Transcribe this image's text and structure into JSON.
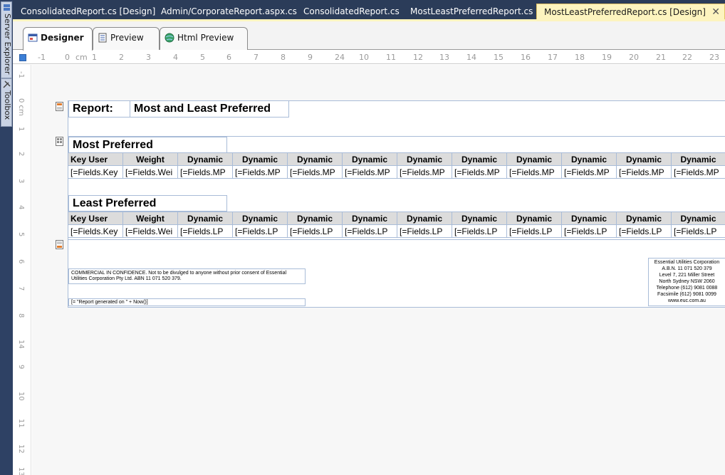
{
  "side_panels": {
    "server_explorer": "Server Explorer",
    "toolbox": "Toolbox"
  },
  "doc_tabs": [
    {
      "label": "ConsolidatedReport.cs [Design]"
    },
    {
      "label": "Admin/CorporateReport.aspx.cs"
    },
    {
      "label": "ConsolidatedReport.cs"
    },
    {
      "label": "MostLeastPreferredReport.cs"
    },
    {
      "label": "MostLeastPreferredReport.cs [Design]",
      "active": true
    }
  ],
  "close_glyph": "✕",
  "view_tabs": {
    "designer": "Designer",
    "preview": "Preview",
    "html_preview": "Html Preview"
  },
  "ruler": {
    "unit": "cm",
    "h_labels": [
      "-1",
      "0",
      "1",
      "2",
      "3",
      "4",
      "5",
      "6",
      "7",
      "8",
      "9",
      "10",
      "11",
      "12",
      "13",
      "14",
      "15",
      "16",
      "17",
      "18",
      "19",
      "20",
      "21",
      "22",
      "23",
      "24"
    ],
    "v_labels": [
      "-1",
      "0 cm",
      "1",
      "2",
      "3",
      "4",
      "5",
      "6",
      "7",
      "8",
      "9",
      "10",
      "11",
      "12",
      "13",
      "14"
    ]
  },
  "report": {
    "title_label": "Report:",
    "title_value": "Most and Least Preferred",
    "most_preferred": {
      "heading": "Most Preferred",
      "columns": [
        "Key User",
        "Weight",
        "Dynamic",
        "Dynamic",
        "Dynamic",
        "Dynamic",
        "Dynamic",
        "Dynamic",
        "Dynamic",
        "Dynamic",
        "Dynamic",
        "Dynamic"
      ],
      "fields": [
        "[=Fields.Key",
        "[=Fields.Wei",
        "[=Fields.MP",
        "[=Fields.MP",
        "[=Fields.MP",
        "[=Fields.MP",
        "[=Fields.MP",
        "[=Fields.MP",
        "[=Fields.MP",
        "[=Fields.MP",
        "[=Fields.MP",
        "[=Fields.MP"
      ]
    },
    "least_preferred": {
      "heading": "Least Preferred",
      "columns": [
        "Key User",
        "Weight",
        "Dynamic",
        "Dynamic",
        "Dynamic",
        "Dynamic",
        "Dynamic",
        "Dynamic",
        "Dynamic",
        "Dynamic",
        "Dynamic",
        "Dynamic"
      ],
      "fields": [
        "[=Fields.Key",
        "[=Fields.Wei",
        "[=Fields.LP",
        "[=Fields.LP",
        "[=Fields.LP",
        "[=Fields.LP",
        "[=Fields.LP",
        "[=Fields.LP",
        "[=Fields.LP",
        "[=Fields.LP",
        "[=Fields.LP",
        "[=Fields.LP"
      ]
    },
    "footer": {
      "confidential": "COMMERCIAL IN CONFIDENCE. Not to be divulged to anyone without prior consent of Essential Utilities Corporation Pty Ltd. ABN 11 071 520 379.",
      "generated": "[= \"Report generated on \" + Now()]",
      "address_lines": [
        "Essential Utilities Corporation",
        "A.B.N. 11 071 520 379",
        "Level 7, 221 Miller Street",
        "North Sydney NSW 2060",
        "Telephone (612) 9081 0088",
        "Facsimile (612) 9081 0099",
        "www.euc.com.au"
      ]
    }
  }
}
